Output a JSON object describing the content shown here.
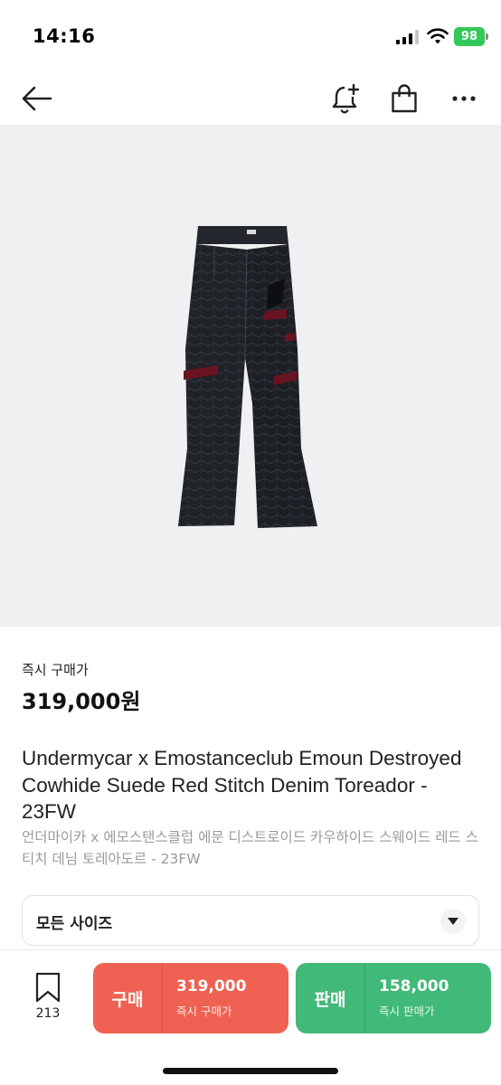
{
  "status_bar": {
    "time": "14:16",
    "battery": "98",
    "battery_color": "#34c759"
  },
  "nav": {
    "icons": [
      "back-arrow-icon",
      "bell-plus-icon",
      "shopping-bag-icon",
      "more-icon"
    ]
  },
  "product": {
    "image_subject": "pants-image",
    "price_label": "즉시 구매가",
    "price": "319,000원",
    "title_en": "Undermycar x Emostanceclub Emoun Destroyed Cowhide Suede Red Stitch Denim Toreador - 23FW",
    "title_ko": "언더마이카 x 에모스탠스클럽 에문 디스트로이드 카우하이드 스웨이드 레드 스티치 데님 토레아도르 - 23FW"
  },
  "size_select": {
    "label": "모든 사이즈"
  },
  "bottom_bar": {
    "wish_count": "213",
    "buy": {
      "label": "구매",
      "price": "319,000",
      "sub": "즉시 구매가",
      "color": "#ef6253"
    },
    "sell": {
      "label": "판매",
      "price": "158,000",
      "sub": "즉시 판매가",
      "color": "#41b979"
    }
  }
}
